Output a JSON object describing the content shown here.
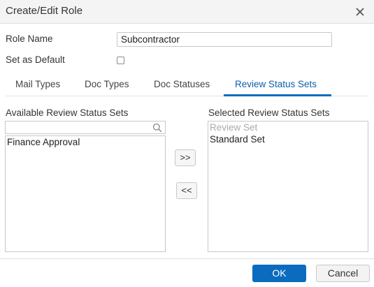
{
  "dialog": {
    "title": "Create/Edit Role"
  },
  "form": {
    "role_name_label": "Role Name",
    "role_name_value": "Subcontractor",
    "default_label": "Set as Default",
    "default_checked": false
  },
  "tabs": [
    {
      "label": "Mail Types",
      "active": false
    },
    {
      "label": "Doc Types",
      "active": false
    },
    {
      "label": "Doc Statuses",
      "active": false
    },
    {
      "label": "Review Status Sets",
      "active": true
    }
  ],
  "available": {
    "label": "Available Review Status Sets",
    "search_value": "",
    "items": [
      "Finance Approval"
    ]
  },
  "selected": {
    "label": "Selected Review Status Sets",
    "placeholder": "Review Set",
    "items": [
      "Standard Set"
    ]
  },
  "move_buttons": {
    "add": ">>",
    "remove": "<<"
  },
  "footer": {
    "ok_label": "OK",
    "cancel_label": "Cancel"
  },
  "colors": {
    "accent": "#0b6cbf",
    "header_bg": "#f4f4f4"
  }
}
